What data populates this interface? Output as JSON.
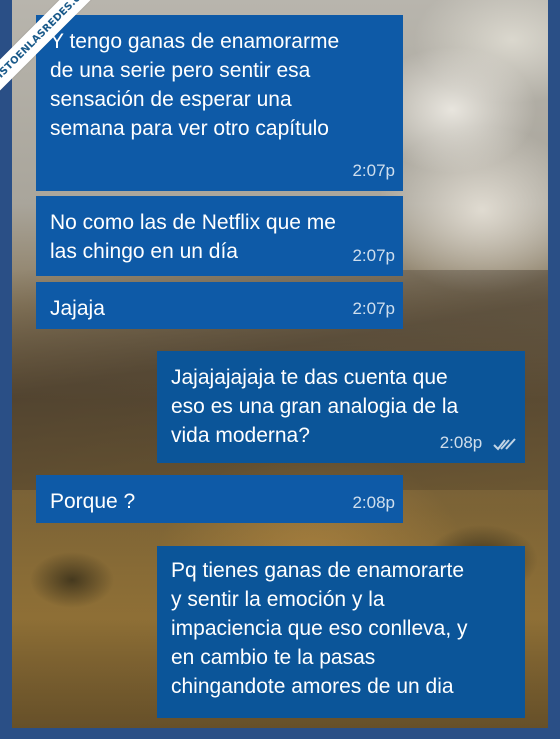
{
  "watermark": {
    "text": "VISTOENLASREDES.com"
  },
  "messages": [
    {
      "text": "Y tengo ganas de enamorarme\nde una serie pero sentir esa\nsensación de esperar una\nsemana para ver otro capítulo",
      "time": "2:07p",
      "direction": "in"
    },
    {
      "text": "No como las de Netflix que me\nlas chingo en un día",
      "time": "2:07p",
      "direction": "in"
    },
    {
      "text": "Jajaja",
      "time": "2:07p",
      "direction": "in"
    },
    {
      "text": "Jajajajajaja te das cuenta que\neso es una gran analogia de la\nvida moderna?",
      "time": "2:08p",
      "direction": "out",
      "status_icon": "double-check-icon"
    },
    {
      "text": "Porque ?",
      "time": "2:08p",
      "direction": "in"
    },
    {
      "text": "Pq tienes ganas de enamorarte\ny sentir la emoción y la\nimpaciencia que eso conlleva, y\nen cambio te la pasas\nchingandote amores de un dia",
      "time": "",
      "direction": "out"
    }
  ],
  "colors": {
    "incoming_bubble": "#0e5aa7",
    "outgoing_bubble": "#0b5599",
    "frame": "#2a4f86"
  }
}
